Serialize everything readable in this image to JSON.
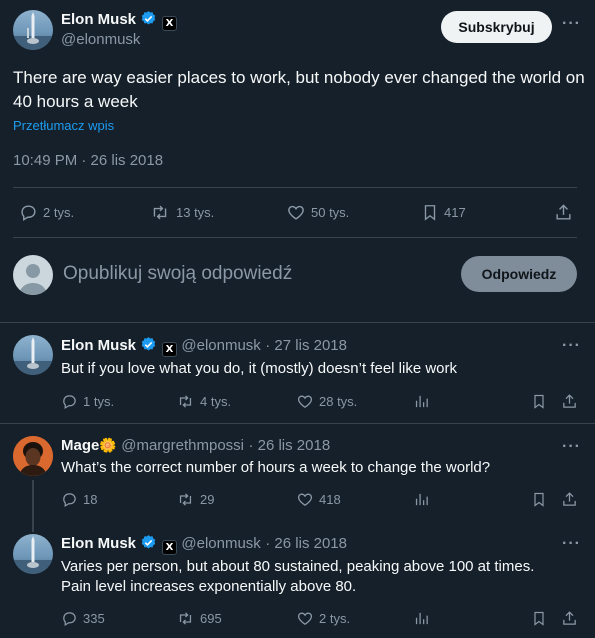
{
  "main_tweet": {
    "author_name": "Elon Musk",
    "author_handle": "@elonmusk",
    "x_badge": "X",
    "subscribe_label": "Subskrybuj",
    "more": "···",
    "text": "There are way easier places to work, but nobody ever changed the world on 40 hours a week",
    "translate_label": "Przetłumacz wpis",
    "timestamp": "10:49 PM · 26 lis 2018",
    "stats": {
      "replies": "2 tys.",
      "retweets": "13 tys.",
      "likes": "50 tys.",
      "bookmarks": "417"
    }
  },
  "reply_box": {
    "placeholder": "Opublikuj swoją odpowiedź",
    "button_label": "Odpowiedz"
  },
  "replies": [
    {
      "author_name": "Elon Musk",
      "author_handle": "@elonmusk",
      "date": "· 27 lis 2018",
      "text": "But if you love what you do, it (mostly) doesn’t feel like work",
      "replies": "1 tys.",
      "retweets": "4 tys.",
      "likes": "28 tys.",
      "more": "···"
    },
    {
      "author_name": "Mage",
      "author_emoji": "🌼",
      "author_handle": "@margrethmpossi",
      "date": "· 26 lis 2018",
      "text": "What’s the correct number of hours a week to change the world?",
      "replies": "18",
      "retweets": "29",
      "likes": "418",
      "more": "···"
    },
    {
      "author_name": "Elon Musk",
      "author_handle": "@elonmusk",
      "date": "· 26 lis 2018",
      "text_line1": "Varies per person, but about 80 sustained, peaking above 100 at times.",
      "text_line2": "Pain level increases exponentially above 80.",
      "replies": "335",
      "retweets": "695",
      "likes": "2 tys.",
      "more": "···"
    }
  ],
  "colors": {
    "background": "#15202b",
    "text": "#f7f9f9",
    "muted": "#8b98a5",
    "accent": "#1d9bf0",
    "divider": "#38444d"
  }
}
